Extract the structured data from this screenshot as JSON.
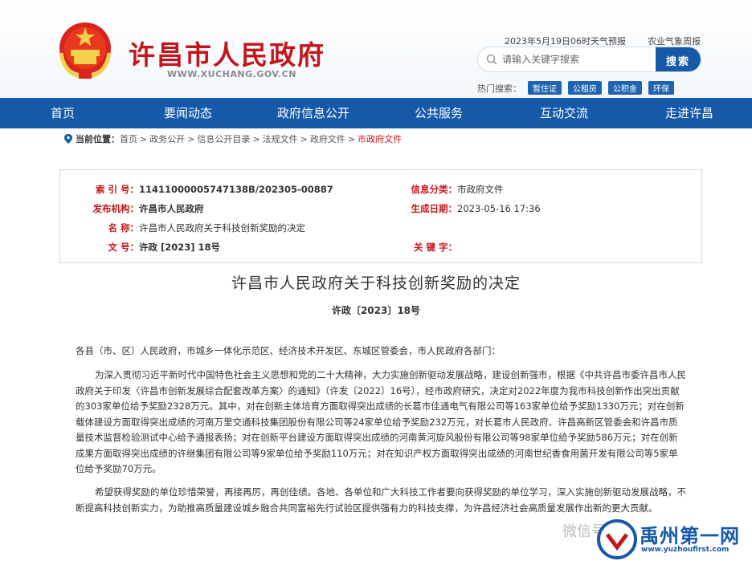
{
  "header": {
    "site_title": "许昌市人民政府",
    "site_url": "WWW.XUCHANG.GOV.CN",
    "weather_text": "2023年5月19日06时天气预报",
    "weather_link": "农业气象周报",
    "search": {
      "placeholder": "请输入关键字搜索",
      "button_label": "搜索"
    },
    "hot_search_label": "热门搜索：",
    "hot_tags": [
      "暂住证",
      "公租房",
      "公积金",
      "环保"
    ]
  },
  "nav": {
    "items": [
      "首页",
      "要闻动态",
      "政府信息公开",
      "公共服务",
      "互动交流",
      "走进许昌"
    ]
  },
  "breadcrumb": {
    "label": "当前位置：",
    "items": [
      "首页",
      "政务公开",
      "信息公开目录",
      "法规文件",
      "政府文件",
      "市政府文件"
    ],
    "separator": ">"
  },
  "info": {
    "index_label": "索 引 号：",
    "index_value": "11411000005747138B/202305-00887",
    "category_label": "信息分类：",
    "category_value": "市政府文件",
    "issuer_label": "发布机构：",
    "issuer_value": "许昌市人民政府",
    "date_label": "生成日期：",
    "date_value": "2023-05-16 17:36",
    "name_label": "名    称：",
    "name_value": "许昌市人民政府关于科技创新奖励的决定",
    "docno_label": "文    号：",
    "docno_value": "许政 [2023] 18号",
    "keywords_label": "关 键 字：",
    "keywords_value": ""
  },
  "document": {
    "title": "许昌市人民政府关于科技创新奖励的决定",
    "number": "许政〔2023〕18号",
    "salutation": "各县（市、区）人民政府，市城乡一体化示范区、经济技术开发区、东城区管委会，市人民政府各部门：",
    "paragraph1": "为深入贯彻习近平新时代中国特色社会主义思想和党的二十大精神，大力实施创新驱动发展战略，建设创新强市，根据《中共许昌市委许昌市人民政府关于印发〈许昌市创新发展综合配套改革方案〉的通知》（许发〔2022〕16号），经市政府研究，决定对2022年度为我市科技创新作出突出贡献的303家单位给予奖励2328万元。其中，对在创新主体培育方面取得突出成绩的长葛市佳通电气有限公司等163家单位给予奖励1330万元；对在创新载体建设方面取得突出成绩的河南万里交通科技集团股份有限公司等24家单位给予奖励232万元，对长葛市人民政府、许昌高新区管委会和许昌市质量技术监督检验测试中心给予通报表扬；对在创新平台建设方面取得突出成绩的河南黄河旋风股份有限公司等98家单位给予奖励586万元；对在创新成果方面取得突出成绩的许继集团有限公司等9家单位给予奖励110万元；对在知识产权方面取得突出成绩的河南世纪香食用菌开发有限公司等5家单位给予奖励70万元。",
    "paragraph2": "希望获得奖励的单位珍惜荣誉，再接再厉，再创佳绩。各地、各单位和广大科技工作者要向获得奖励的单位学习，深入实施创新驱动发展战略，不断提高科技创新实力，为助推高质量建设城乡融合共同富裕先行试验区提供强有力的科技支撑，为许昌经济社会高质量发展作出新的更大贡献。"
  },
  "watermark": {
    "brand": "禹州第一网",
    "url": "www.yuzhoufirst.com",
    "wechat_text": "微信号"
  },
  "colors": {
    "primary_blue": "#1559a8",
    "accent_red": "#c4151c"
  }
}
